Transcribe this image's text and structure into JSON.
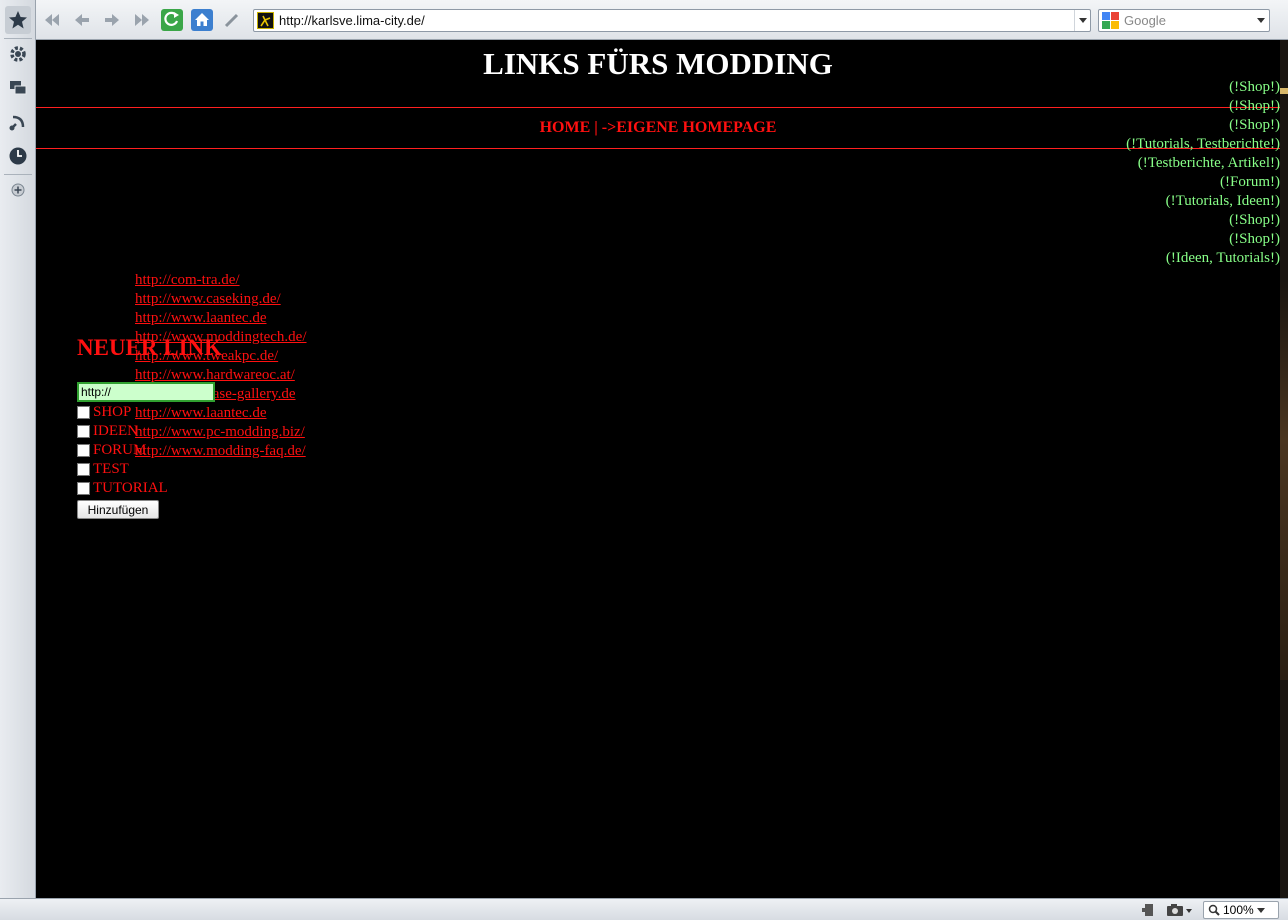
{
  "browser": {
    "address_url": "http://karlsve.lima-city.de/",
    "search_placeholder": "Google",
    "zoom": "100%"
  },
  "page": {
    "title": "LINKS FÜRS MODDING",
    "nav_text": "HOME | ->EIGENE HOMEPAGE",
    "links": [
      "http://com-tra.de/",
      "http://www.caseking.de/",
      "http://www.laantec.de",
      "http://www.moddingtech.de/",
      "http://www.tweakpc.de/",
      "http://www.hardwareoc.at/",
      "http://www.case-gallery.de",
      "http://www.laantec.de",
      "http://www.pc-modding.biz/",
      "http://www.modding-faq.de/"
    ],
    "tags": [
      "(!Shop!)",
      "(!Shop!)",
      "(!Shop!)",
      "(!Tutorials, Testberichte!)",
      "(!Testberichte, Artikel!)",
      "(!Forum!)",
      "(!Tutorials, Ideen!)",
      "(!Shop!)",
      "(!Shop!)",
      "(!Ideen, Tutorials!)"
    ],
    "form": {
      "title": "NEUER LINK",
      "url_value": "http://",
      "checkboxes": [
        "SHOP",
        "IDEEN",
        "FORUM",
        "TEST",
        "TUTORIAL"
      ],
      "submit_label": "Hinzufügen"
    }
  },
  "colors": {
    "background": "#000000",
    "link": "#ff1010",
    "tag": "#88ff88",
    "title": "#ffffff",
    "divider": "#ff2020"
  }
}
